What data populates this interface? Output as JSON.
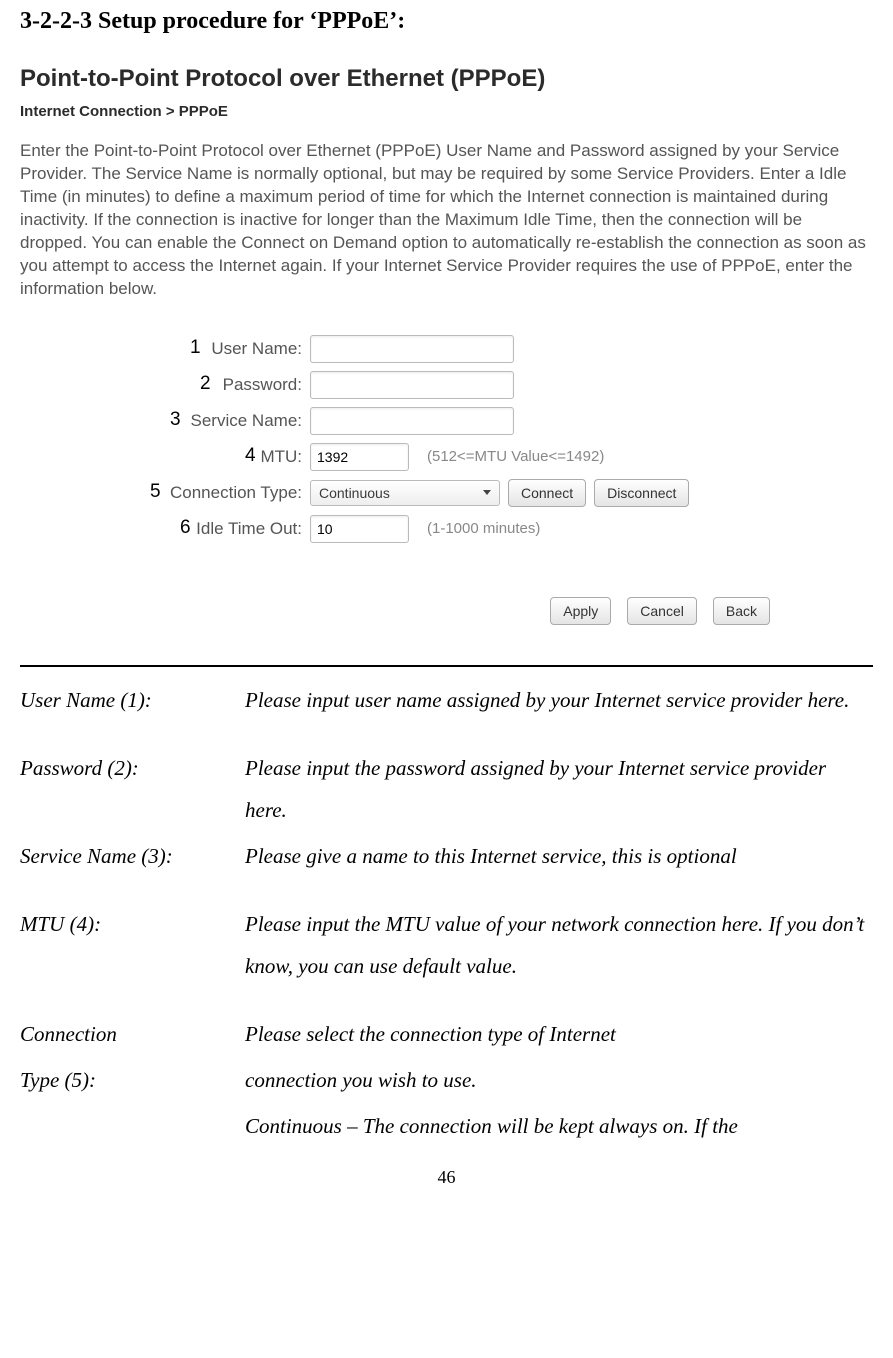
{
  "section_title": "3-2-2-3 Setup procedure for ‘PPPoE’:",
  "ui": {
    "title": "Point-to-Point Protocol over Ethernet (PPPoE)",
    "breadcrumb": "Internet Connection > PPPoE",
    "paragraph": "Enter the Point-to-Point Protocol over Ethernet (PPPoE) User Name and Password assigned by your Service Provider. The Service Name is normally optional, but may be required by some Service Providers. Enter a Idle Time (in minutes) to define a maximum period of time for which the Internet connection is maintained during inactivity. If the connection is inactive for longer than the Maximum Idle Time, then the connection will be dropped. You can enable the Connect on Demand option to automatically re-establish the connection as soon as you attempt to access the Internet again. If your Internet Service Provider requires the use of PPPoE, enter the information below."
  },
  "callouts": {
    "c1": "1",
    "c2": "2",
    "c3": "3",
    "c4": "4",
    "c5": "5",
    "c6": "6"
  },
  "form": {
    "user_name_label": "User Name:",
    "user_name_value": "",
    "password_label": "Password:",
    "password_value": "",
    "service_name_label": "Service Name:",
    "service_name_value": "",
    "mtu_label": "MTU:",
    "mtu_value": "1392",
    "mtu_hint": "(512<=MTU Value<=1492)",
    "connection_type_label": "Connection Type:",
    "connection_type_value": "Continuous",
    "connect_btn": "Connect",
    "disconnect_btn": "Disconnect",
    "idle_label": "Idle Time Out:",
    "idle_value": "10",
    "idle_hint": "(1-1000 minutes)"
  },
  "buttons": {
    "apply": "Apply",
    "cancel": "Cancel",
    "back": "Back"
  },
  "descriptions": [
    {
      "term": "User Name (1):",
      "text": "Please input user name assigned by your Internet service provider here."
    },
    {
      "term": "",
      "text": ""
    },
    {
      "term": "Password (2):",
      "text": "Please input the password assigned by your Internet service provider here."
    },
    {
      "term": "Service Name (3):",
      "text": "Please give a name to this Internet service, this is optional"
    },
    {
      "term": "",
      "text": ""
    },
    {
      "term": "MTU (4):",
      "text": "Please input the MTU value of your network connection here. If you don’t know, you can use default value."
    },
    {
      "term": "",
      "text": ""
    },
    {
      "term": "Connection",
      "text": "Please select the connection type of Internet"
    },
    {
      "term": "Type (5):",
      "text": "connection you wish to use."
    },
    {
      "term": "",
      "text": "Continuous – The connection will be kept always on. If the"
    }
  ],
  "page_number": "46"
}
